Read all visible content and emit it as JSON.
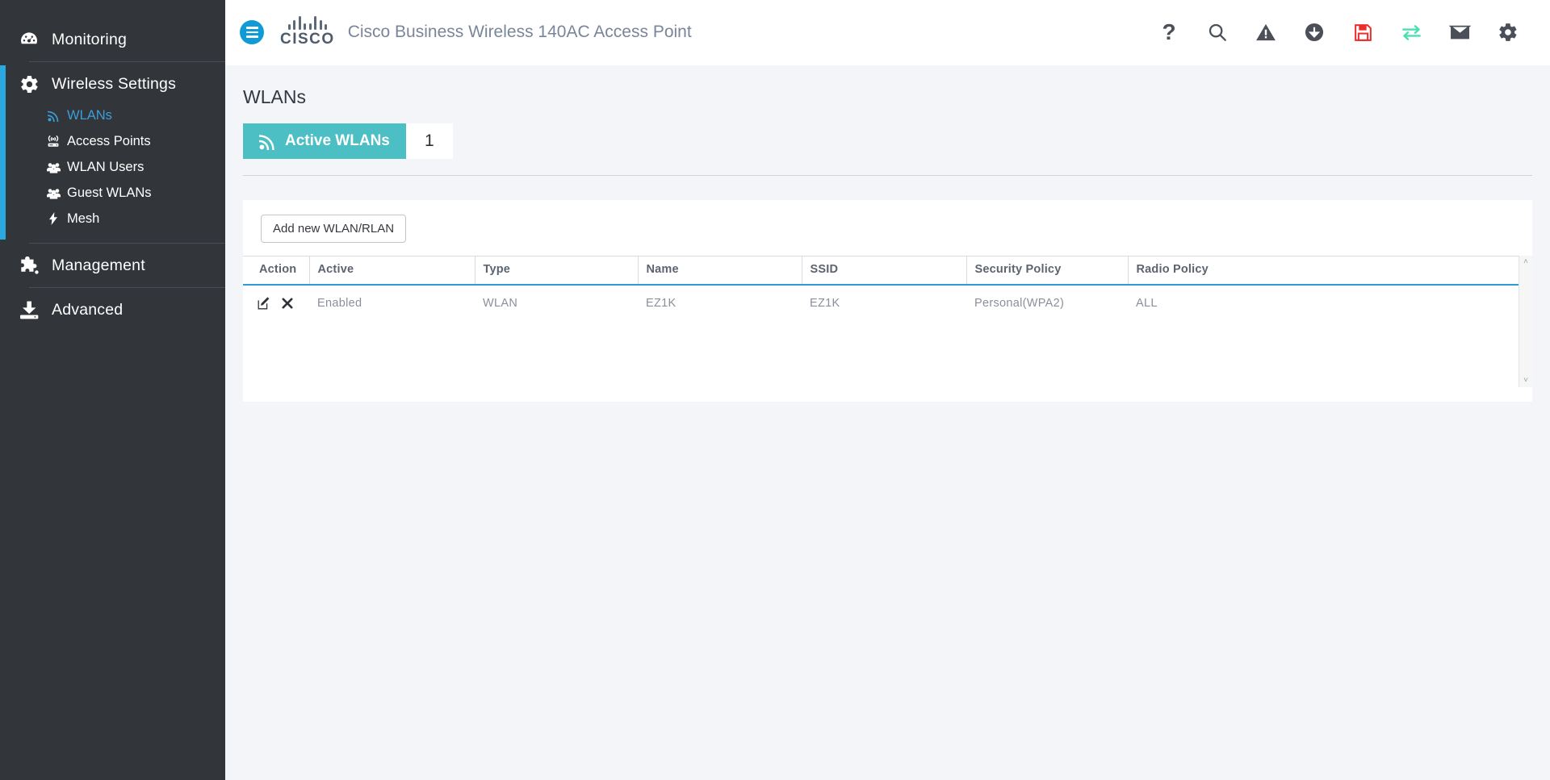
{
  "header": {
    "menu_icon": "hamburger-icon",
    "brand": "CISCO",
    "app_title": "Cisco Business Wireless 140AC Access Point",
    "icons": [
      {
        "name": "help-icon",
        "label": "Help",
        "glyph": "?"
      },
      {
        "name": "search-icon",
        "label": "Search",
        "glyph": "search"
      },
      {
        "name": "alert-icon",
        "label": "Alerts",
        "glyph": "warning"
      },
      {
        "name": "download-icon",
        "label": "Download",
        "glyph": "download"
      },
      {
        "name": "save-icon",
        "label": "Save Configuration",
        "glyph": "floppy",
        "color": "#ef2b2b"
      },
      {
        "name": "transfer-icon",
        "label": "Transfer",
        "glyph": "transfer",
        "color": "#49dfb0"
      },
      {
        "name": "mail-icon",
        "label": "Mail",
        "glyph": "envelope"
      },
      {
        "name": "settings-icon",
        "label": "Settings",
        "glyph": "gear"
      }
    ]
  },
  "sidebar": {
    "accent_color": "#2ba8e0",
    "background": "#32353a",
    "groups": [
      {
        "name": "monitoring",
        "label": "Monitoring",
        "icon": "dashboard-gauge-icon",
        "active": false,
        "items": []
      },
      {
        "name": "wireless-settings",
        "label": "Wireless Settings",
        "icon": "gear-icon",
        "active": true,
        "items": [
          {
            "name": "wlans",
            "label": "WLANs",
            "icon": "wifi-signal-icon",
            "selected": true
          },
          {
            "name": "access-points",
            "label": "Access Points",
            "icon": "access-point-icon",
            "selected": false
          },
          {
            "name": "wlan-users",
            "label": "WLAN Users",
            "icon": "users-icon",
            "selected": false
          },
          {
            "name": "guest-wlans",
            "label": "Guest WLANs",
            "icon": "users-icon",
            "selected": false
          },
          {
            "name": "mesh",
            "label": "Mesh",
            "icon": "bolt-icon",
            "selected": false
          }
        ]
      },
      {
        "name": "management",
        "label": "Management",
        "icon": "puzzle-piece-icon",
        "active": false,
        "items": []
      },
      {
        "name": "advanced",
        "label": "Advanced",
        "icon": "download-tray-icon",
        "active": false,
        "items": []
      }
    ]
  },
  "main": {
    "page_title": "WLANs",
    "badge": {
      "icon": "wifi-signal-icon",
      "label": "Active WLANs",
      "count": "1",
      "color": "#4bbfc3"
    },
    "toolbar": {
      "add_button_label": "Add new WLAN/RLAN"
    },
    "table": {
      "columns": [
        "Action",
        "Active",
        "Type",
        "Name",
        "SSID",
        "Security Policy",
        "Radio Policy"
      ],
      "rows": [
        {
          "actions": [
            {
              "name": "edit-icon",
              "label": "Edit"
            },
            {
              "name": "delete-icon",
              "label": "Delete"
            }
          ],
          "active": "Enabled",
          "type": "WLAN",
          "wlan_name": "EZ1K",
          "ssid": "EZ1K",
          "security_policy": "Personal(WPA2)",
          "radio_policy": "ALL"
        }
      ]
    },
    "scrollbar": {
      "up_glyph": "˄",
      "down_glyph": "˅"
    }
  }
}
